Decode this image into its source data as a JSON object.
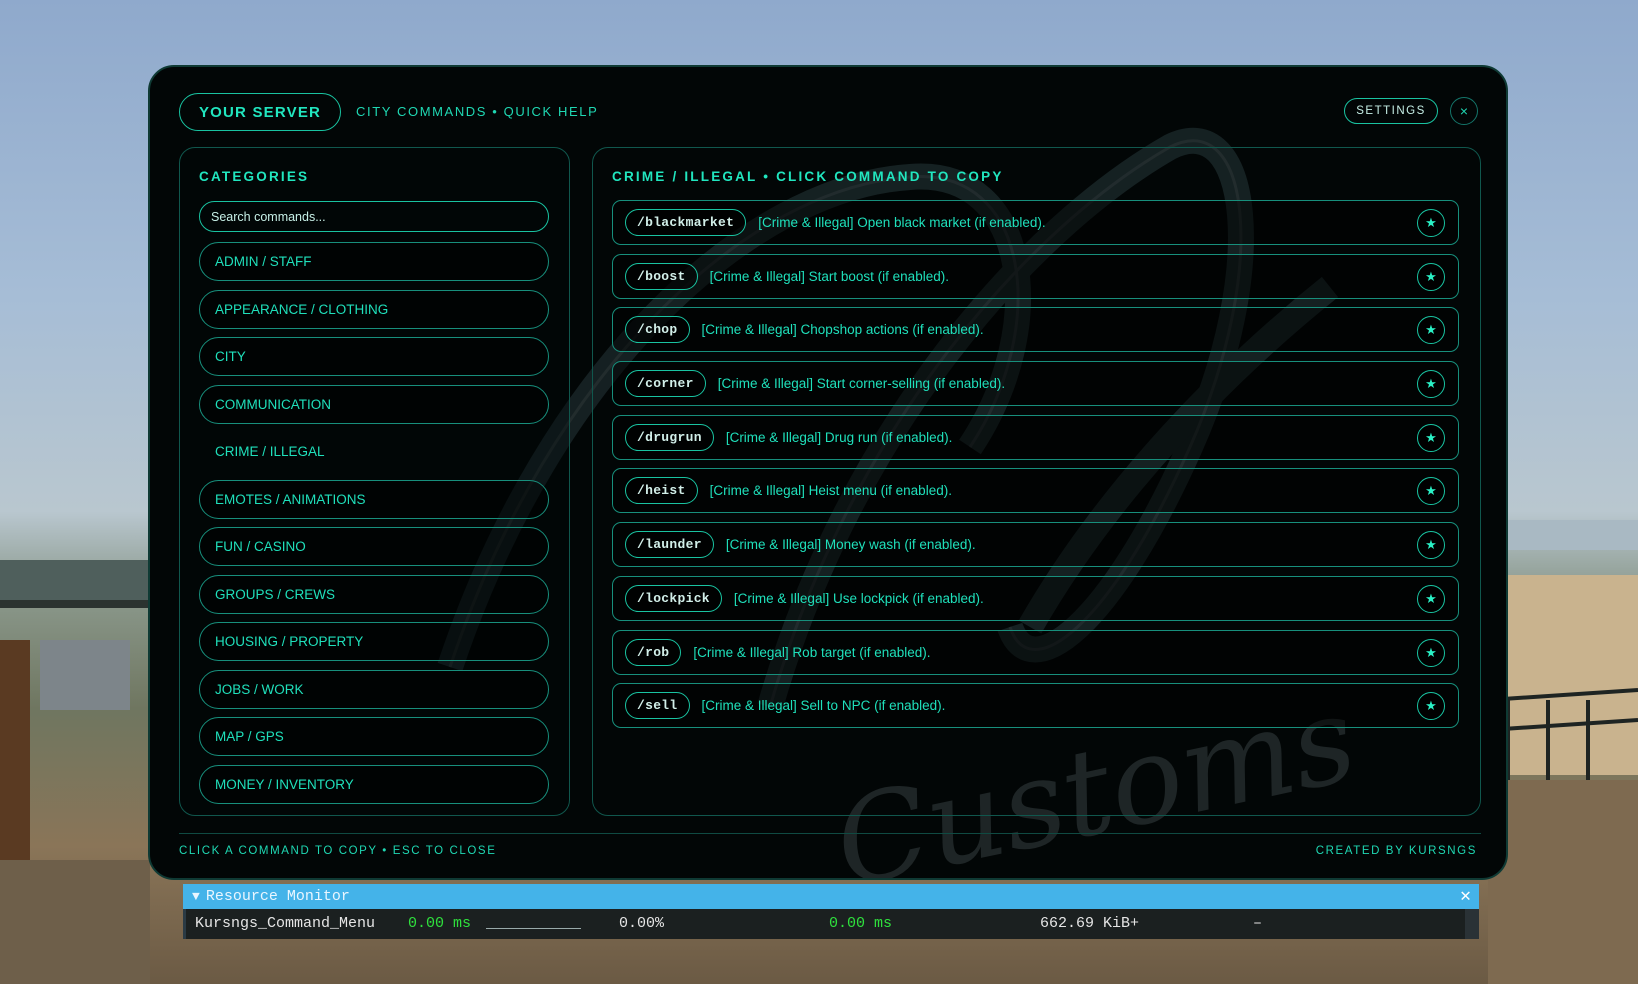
{
  "header": {
    "server_label": "YOUR SERVER",
    "title": "CITY COMMANDS • QUICK HELP",
    "settings_label": "SETTINGS",
    "close_label": "×"
  },
  "categories": {
    "heading": "CATEGORIES",
    "search_placeholder": "Search commands...",
    "active": "CRIME / ILLEGAL",
    "items": [
      {
        "label": "ADMIN / STAFF"
      },
      {
        "label": "APPEARANCE / CLOTHING"
      },
      {
        "label": "CITY"
      },
      {
        "label": "COMMUNICATION"
      },
      {
        "label": "CRIME / ILLEGAL"
      },
      {
        "label": "EMOTES / ANIMATIONS"
      },
      {
        "label": "FUN / CASINO"
      },
      {
        "label": "GROUPS / CREWS"
      },
      {
        "label": "HOUSING / PROPERTY"
      },
      {
        "label": "JOBS / WORK"
      },
      {
        "label": "MAP / GPS"
      },
      {
        "label": "MONEY / INVENTORY"
      }
    ]
  },
  "commands": {
    "heading": "CRIME / ILLEGAL • CLICK COMMAND TO COPY",
    "star_icon": "★",
    "items": [
      {
        "cmd": "/blackmarket",
        "desc": "[Crime & Illegal] Open black market (if enabled)."
      },
      {
        "cmd": "/boost",
        "desc": "[Crime & Illegal] Start boost (if enabled)."
      },
      {
        "cmd": "/chop",
        "desc": "[Crime & Illegal] Chopshop actions (if enabled)."
      },
      {
        "cmd": "/corner",
        "desc": "[Crime & Illegal] Start corner-selling (if enabled)."
      },
      {
        "cmd": "/drugrun",
        "desc": "[Crime & Illegal] Drug run (if enabled)."
      },
      {
        "cmd": "/heist",
        "desc": "[Crime & Illegal] Heist menu (if enabled)."
      },
      {
        "cmd": "/launder",
        "desc": "[Crime & Illegal] Money wash (if enabled)."
      },
      {
        "cmd": "/lockpick",
        "desc": "[Crime & Illegal] Use lockpick (if enabled)."
      },
      {
        "cmd": "/rob",
        "desc": "[Crime & Illegal] Rob target (if enabled)."
      },
      {
        "cmd": "/sell",
        "desc": "[Crime & Illegal] Sell to NPC (if enabled)."
      }
    ]
  },
  "footer": {
    "left": "CLICK A COMMAND TO COPY • ESC TO CLOSE",
    "right": "CREATED BY KURSNGS"
  },
  "watermark": {
    "text": "Customs"
  },
  "resource_monitor": {
    "title": "Resource Monitor",
    "toggle_icon": "▼",
    "close_icon": "✕",
    "row": {
      "name": "Kursngs_Command_Menu",
      "cpu_ms": "0.00 ms",
      "cpu_pct": "0.00%",
      "tick_ms": "0.00 ms",
      "memory": "662.69 KiB+",
      "extra": "–"
    }
  },
  "colors": {
    "accent": "#21e6bf",
    "panel_bg": "#020606",
    "resmon_title_bg": "#44b3e9",
    "resmon_green": "#2fe03d"
  }
}
